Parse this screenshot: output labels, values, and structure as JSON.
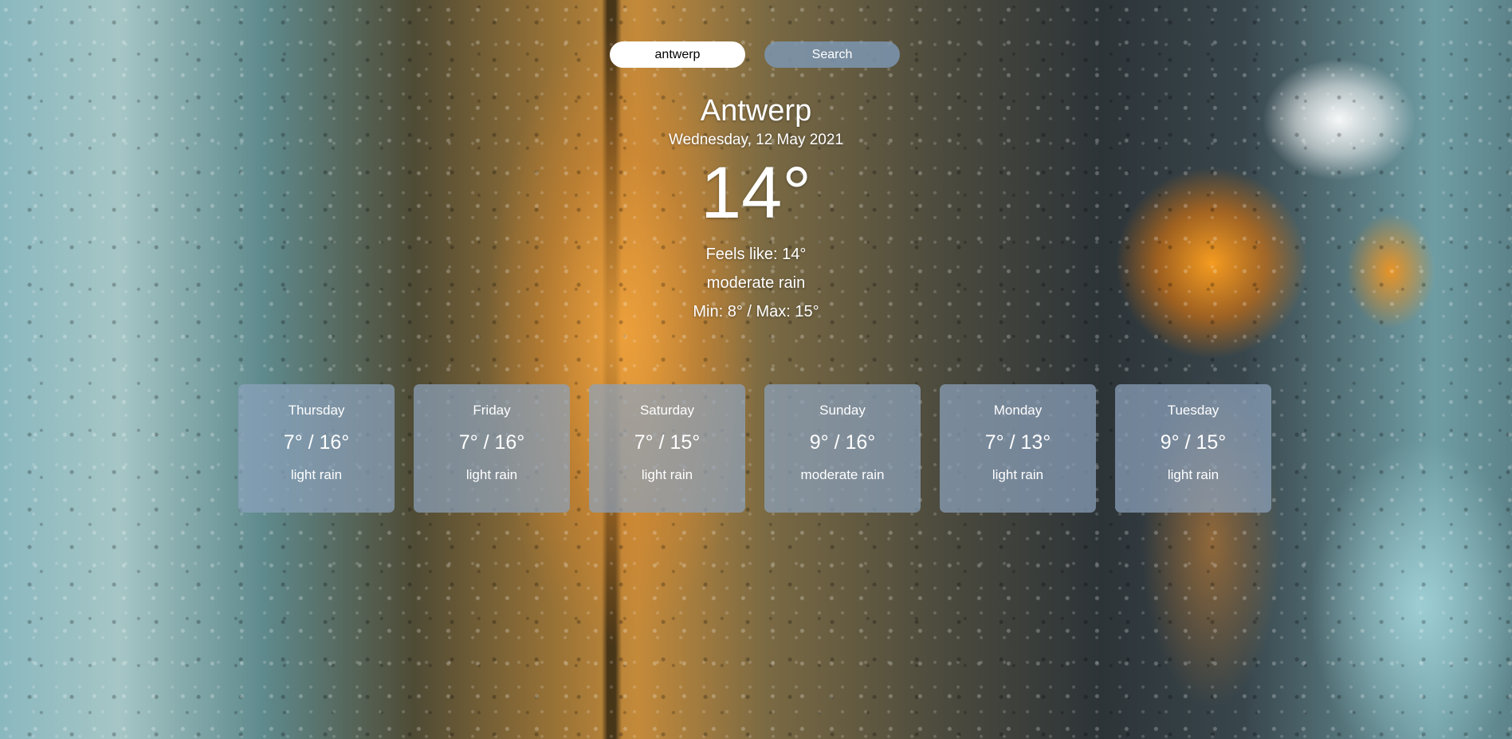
{
  "search": {
    "value": "antwerp",
    "button_label": "Search"
  },
  "current": {
    "city": "Antwerp",
    "date": "Wednesday, 12 May 2021",
    "temperature": "14°",
    "feels_like": "Feels like: 14°",
    "description": "moderate rain",
    "min_max": "Min: 8° / Max: 15°"
  },
  "forecast": [
    {
      "day": "Thursday",
      "temps": "7° / 16°",
      "description": "light rain"
    },
    {
      "day": "Friday",
      "temps": "7° / 16°",
      "description": "light rain"
    },
    {
      "day": "Saturday",
      "temps": "7° / 15°",
      "description": "light rain"
    },
    {
      "day": "Sunday",
      "temps": "9° / 16°",
      "description": "moderate rain"
    },
    {
      "day": "Monday",
      "temps": "7° / 13°",
      "description": "light rain"
    },
    {
      "day": "Tuesday",
      "temps": "9° / 15°",
      "description": "light rain"
    }
  ],
  "colors": {
    "card_background": "#8ca2bc",
    "button_background": "#7d96b2",
    "text": "#ffffff"
  }
}
